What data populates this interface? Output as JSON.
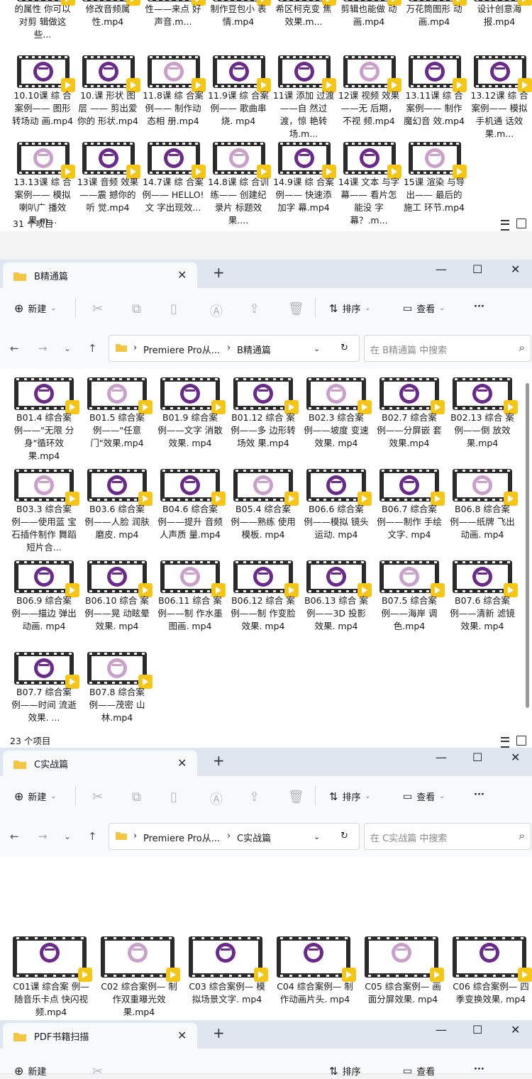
{
  "colors": {
    "purple": "#6a2a8a",
    "pink_light": "#c9a0c9",
    "folder_yellow": "#f4c542",
    "badge_yellow": "#f5c518",
    "tab_bar": "#dfe6ef"
  },
  "icons": {
    "folder": "folder-icon",
    "new": "plus-circle-icon",
    "cut": "scissors-icon",
    "copy": "copy-icon",
    "paste": "clipboard-icon",
    "rename": "rename-icon",
    "share": "share-icon",
    "delete": "trash-icon",
    "sort": "sort-icon",
    "view": "view-icon",
    "more": "ellipsis-icon",
    "back": "arrow-left-icon",
    "forward": "arrow-right-icon",
    "recent": "chevron-down-icon",
    "up": "arrow-up-icon",
    "refresh": "refresh-icon",
    "search": "search-icon",
    "close": "close-icon",
    "minimize": "minimize-icon",
    "maximize": "maximize-icon"
  },
  "toolbar": {
    "new_label": "新建",
    "sort_label": "排序",
    "view_label": "查看",
    "more_label": "···"
  },
  "window_top": {
    "status": "31 个项目",
    "items": [
      {
        "name": "的属性 你可以对剪 辑做这些..."
      },
      {
        "name": "修改音频属 性.mp4"
      },
      {
        "name": "性——来点 好声音.m..."
      },
      {
        "name": "制作豆包小 表情.mp4"
      },
      {
        "name": "希区柯克变 焦效果.m..."
      },
      {
        "name": "剪辑也能做 动画.mp4"
      },
      {
        "name": "万花筒图形 动画.mp4"
      },
      {
        "name": "设计创意海 报.mp4"
      },
      {
        "name": "10.10课 综 合案例—— 图形转场动 画.mp4"
      },
      {
        "name": "10.课 形状 图层 —— 剪出爱你的 形状.mp4"
      },
      {
        "name": "11.8课 综 合案例—— 制作动态相 册.mp4"
      },
      {
        "name": "11.9课 综 合案例—— 歌曲串烧. mp4"
      },
      {
        "name": "11课 添加 过渡——自 然过渡，惊 艳转场.m..."
      },
      {
        "name": "12课 视频 效果——无 后期，不视 频.mp4"
      },
      {
        "name": "13.11课 综 合案例—— 制作魔幻音 效.mp4"
      },
      {
        "name": "13.12课 综 合案例—— 模拟手机通 话效果.m..."
      },
      {
        "name": "13.13课 综 合案例—— 模拟喇叭广 播效果.m..."
      },
      {
        "name": "13课 音频 效果——震 撼你的听 觉.mp4"
      },
      {
        "name": "14.7课 综 合案例—— HELLO!文 字出现效..."
      },
      {
        "name": "14.8课 综 合训练—— 创建纪录片 标题效果...."
      },
      {
        "name": "14.9课 综 合案例—— 快速添加字 幕.mp4"
      },
      {
        "name": "14课 文本 与字幕—— 看片怎能没 字幕？.m..."
      },
      {
        "name": "15课 渲染 与导出—— 最后的施工 环节.mp4"
      }
    ]
  },
  "window_b": {
    "tab_title": "B精通篇",
    "breadcrumb": [
      "Premiere Pro从...",
      "B精通篇"
    ],
    "search_placeholder": "在 B精通篇 中搜索",
    "status": "23 个项目",
    "items": [
      {
        "name": "B01.4 综合案 例——\"无限 分身\"循环效 果.mp4"
      },
      {
        "name": "B01.5 综合案 例——\"任意 门\"效果.mp4"
      },
      {
        "name": "B01.9 综合案 例——文字 消散效果. mp4"
      },
      {
        "name": "B01.12 综合 案例——多 边形转场效 果.mp4"
      },
      {
        "name": "B02.3 综合案 例——坡度 变速效果. mp4"
      },
      {
        "name": "B02.7 综合案 例——分屏嵌 套效果.mp4"
      },
      {
        "name": "B02.13 综合 案例——倒 放效果.mp4"
      },
      {
        "name": "B03.3 综合案 例——使用蓝 宝石插件制作 舞蹈短片合..."
      },
      {
        "name": "B03.6 综合案 例——人脸 润肤磨皮. mp4"
      },
      {
        "name": "B04.6 综合案 例——提升 音频人声质 量.mp4"
      },
      {
        "name": "B05.4 综合案 例——熟练 使用模板. mp4"
      },
      {
        "name": "B06.6 综合案 例——模拟 镜头运动. mp4"
      },
      {
        "name": "B06.7 综合案 例——制作 手绘文字. mp4"
      },
      {
        "name": "B06.8 综合案 例——纸牌 飞出动画. mp4"
      },
      {
        "name": "B06.9 综合案 例——描边 弹出动画. mp4"
      },
      {
        "name": "B06.10 综合 案例——晃 动眩晕效果. mp4"
      },
      {
        "name": "B06.11 综合 案例——制 作水墨图画. mp4"
      },
      {
        "name": "B06.12 综合 案例——制 作变脸效果. mp4"
      },
      {
        "name": "B06.13 综合 案例——3D 投影效果. mp4"
      },
      {
        "name": "B07.5 综合案 例——海岸 调色.mp4"
      },
      {
        "name": "B07.6 综合案 例——清新 滤镜效果. mp4"
      },
      {
        "name": "B07.7 综合案 例——时间 流逝效果. ..."
      },
      {
        "name": "B07.8 综合案 例——茂密 山林.mp4"
      }
    ]
  },
  "window_c": {
    "tab_title": "C实战篇",
    "breadcrumb": [
      "Premiere Pro从...",
      "C实战篇"
    ],
    "search_placeholder": "在 C实战篇 中搜索",
    "items": [
      {
        "name": "C01课 综合案 例—随音乐卡点 快闪视频.mp4"
      },
      {
        "name": "C02 综合案例— 制作双重曝光效 果.mp4"
      },
      {
        "name": "C03 综合案例— 模拟场景文字. mp4"
      },
      {
        "name": "C04 综合案例— 制作动画片头. mp4"
      },
      {
        "name": "C05 综合案例— 画面分屏效果. mp4"
      },
      {
        "name": "C06 综合案例— 四季变换效果. mp4"
      }
    ]
  },
  "window_pdf": {
    "tab_title": "PDF书籍扫描"
  }
}
